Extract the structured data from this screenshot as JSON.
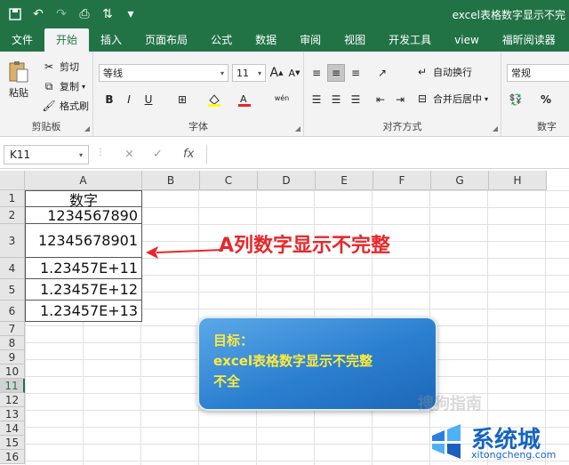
{
  "window": {
    "title": "excel表格数字显示不完"
  },
  "ribbon_tabs": [
    "文件",
    "开始",
    "插入",
    "页面布局",
    "公式",
    "数据",
    "审阅",
    "视图",
    "开发工具",
    "view",
    "福昕阅读器"
  ],
  "clipboard": {
    "paste": "粘贴",
    "cut": "剪切",
    "copy": "复制",
    "format_painter": "格式刷",
    "label": "剪贴板"
  },
  "font": {
    "name": "等线",
    "size": "11",
    "label": "字体",
    "bold": "B",
    "italic": "I",
    "underline": "U",
    "grow": "A",
    "shrink": "A"
  },
  "alignment": {
    "wrap": "自动换行",
    "merge": "合并后居中",
    "label": "对齐方式"
  },
  "number": {
    "format": "常规",
    "percent": "%",
    "label": "数字"
  },
  "formula_bar": {
    "name_box": "K11",
    "fx": "fx",
    "cancel": "×",
    "enter": "✓"
  },
  "columns": [
    "A",
    "B",
    "C",
    "D",
    "E",
    "F",
    "G",
    "H"
  ],
  "rows": [
    "1",
    "2",
    "3",
    "4",
    "5",
    "6",
    "7",
    "8",
    "9",
    "10",
    "11",
    "12",
    "13",
    "14",
    "15",
    "16"
  ],
  "active_row": "11",
  "cells": {
    "A1": "数字",
    "A2": "1234567890",
    "A3": "12345678901",
    "A4": "1.23457E+11",
    "A5": "1.23457E+12",
    "A6": "1.23457E+13"
  },
  "annotation": {
    "callout": "A列数字显示不完整",
    "arrow_color": "#e8272a"
  },
  "goal": {
    "title": "目标：",
    "line1": "excel表格数字显示不完整",
    "line2": "不全"
  },
  "watermarks": {
    "sogou": "搜狗指南",
    "brand": "系统城",
    "url": "xitongcheng.com"
  },
  "colors": {
    "excel_green": "#217346",
    "callout_red": "#e8272a",
    "goal_text": "#ffeb3b"
  }
}
